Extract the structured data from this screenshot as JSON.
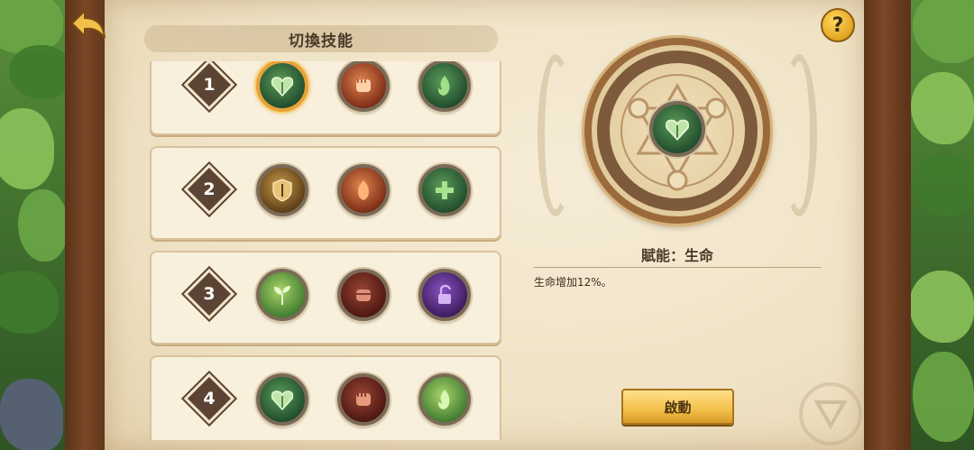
{
  "header": {
    "title": "切換技能"
  },
  "rows": [
    {
      "number": "1",
      "skills": [
        {
          "icon": "heart-leaf-icon",
          "color": "green",
          "selected": true
        },
        {
          "icon": "fist-icon",
          "color": "red",
          "selected": false
        },
        {
          "icon": "green-flame-icon",
          "color": "green",
          "selected": false
        }
      ]
    },
    {
      "number": "2",
      "skills": [
        {
          "icon": "shield-sword-icon",
          "color": "gold",
          "selected": false
        },
        {
          "icon": "fire-hand-icon",
          "color": "red",
          "selected": false
        },
        {
          "icon": "green-cross-icon",
          "color": "green",
          "selected": false
        }
      ]
    },
    {
      "number": "3",
      "skills": [
        {
          "icon": "sprout-icon",
          "color": "green-light",
          "selected": false
        },
        {
          "icon": "grip-fist-icon",
          "color": "dark-red",
          "selected": false
        },
        {
          "icon": "unlock-icon",
          "color": "purple",
          "selected": false
        }
      ]
    },
    {
      "number": "4",
      "skills": [
        {
          "icon": "heart-leaf-icon",
          "color": "green",
          "selected": false
        },
        {
          "icon": "fist-icon",
          "color": "dark-red",
          "selected": false
        },
        {
          "icon": "green-flame-icon",
          "color": "green-light",
          "selected": false
        }
      ]
    }
  ],
  "detail": {
    "center_icon": "heart-leaf-icon",
    "title": "賦能：生命",
    "description": "生命增加12%。",
    "activate_label": "啟動"
  },
  "help": {
    "label": "?"
  },
  "colors": {
    "accent": "#f2c04a",
    "panel": "#f8efdc",
    "text": "#4a3a2a"
  }
}
